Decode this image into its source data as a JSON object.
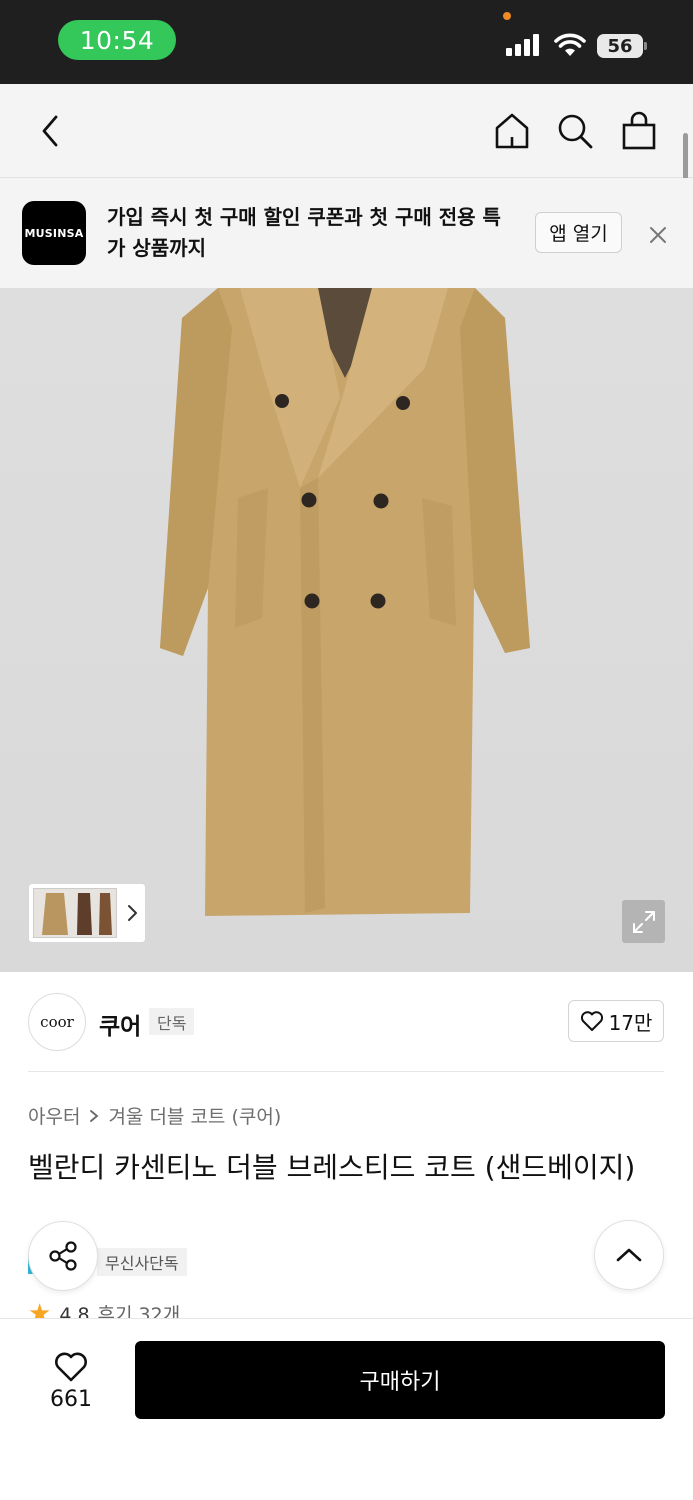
{
  "status_bar": {
    "time": "10:54",
    "battery_level": "56",
    "icons": [
      "cellular-signal-icon",
      "wifi-icon",
      "battery-icon"
    ]
  },
  "nav": {
    "icons": [
      "back-chevron-icon",
      "home-icon",
      "search-icon",
      "shopping-bag-icon"
    ]
  },
  "app_banner": {
    "logo_text": "MUSINSA",
    "message": "가입 즉시 첫 구매 할인 쿠폰과 첫 구매 전용 특가 상품까지",
    "open_app_label": "앱 열기",
    "close_icon": "close-icon"
  },
  "product_image": {
    "background_color": "#dcdcdc",
    "coat_color": "#c7a46a",
    "thumbnail_arrow_icon": "chevron-right-icon",
    "expand_icon": "expand-icon"
  },
  "brand": {
    "logo_text": "coor",
    "name": "쿠어",
    "tag": "단독",
    "like_count": "17만",
    "like_icon": "heart-outline-icon"
  },
  "product": {
    "breadcrumb": [
      "아우터",
      "겨울 더블 코트 (쿠어)"
    ],
    "title": "벨란디 카센티노 더블 브레스티드 코트 (샌드베이지)",
    "exclusive_tag": "무신사단독",
    "rating": "4.8",
    "review_text": "후기 32개",
    "share_icon": "share-icon",
    "scroll_top_icon": "chevron-up-icon"
  },
  "bottom_bar": {
    "wish_count": "661",
    "buy_label": "구매하기"
  }
}
